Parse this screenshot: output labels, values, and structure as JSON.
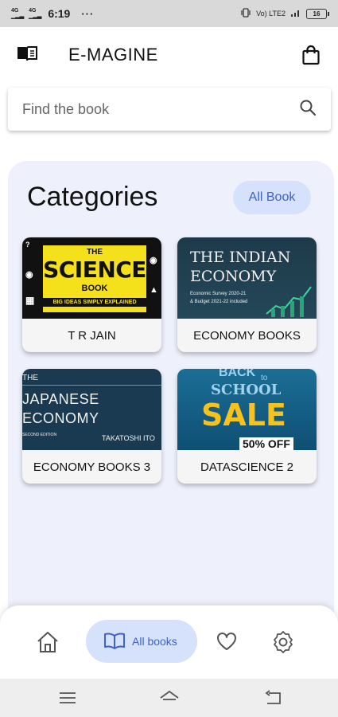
{
  "status_bar": {
    "signal_1": "4G",
    "signal_2": "4G",
    "time": "6:19",
    "overflow": "···",
    "network": "Vo) LTE2",
    "battery": "16"
  },
  "header": {
    "title": "E-MAGINE",
    "menu_icon": "book-menu-icon",
    "cart_icon": "shopping-bag-icon"
  },
  "search": {
    "placeholder": "Find the book",
    "icon": "search-icon"
  },
  "categories": {
    "title": "Categories",
    "all_button": "All Book",
    "items": [
      {
        "label": "T R JAIN",
        "cover": {
          "line1": "THE",
          "line2": "SCIENCE",
          "line3": "BOOK",
          "line4": "BIG IDEAS SIMPLY EXPLAINED"
        }
      },
      {
        "label": "ECONOMY BOOKS",
        "cover": {
          "line1": "THE INDIAN",
          "line2": "ECONOMY",
          "line3": "Economic Survey 2020-21",
          "line4": "& Budget 2021-22 included"
        }
      },
      {
        "label": "ECONOMY BOOKS 3",
        "cover": {
          "line1": "THE",
          "line2": "JAPANESE",
          "line3": "ECONOMY",
          "line4": "SECOND EDITION",
          "line5": "TAKATOSHI ITO"
        }
      },
      {
        "label": "DATASCIENCE 2",
        "cover": {
          "line1": "BACK",
          "line2": "to",
          "line3": "SCHOOL",
          "line4": "SALE",
          "line5": "50% OFF"
        }
      }
    ]
  },
  "bottom_nav": {
    "items": [
      {
        "icon": "home-icon",
        "label": ""
      },
      {
        "icon": "open-book-icon",
        "label": "All books",
        "active": true
      },
      {
        "icon": "heart-icon",
        "label": ""
      },
      {
        "icon": "settings-icon",
        "label": ""
      }
    ]
  },
  "colors": {
    "accent": "#3d62c8",
    "accent_light": "#d6e1fb",
    "panel_bg": "#eef1fb"
  }
}
